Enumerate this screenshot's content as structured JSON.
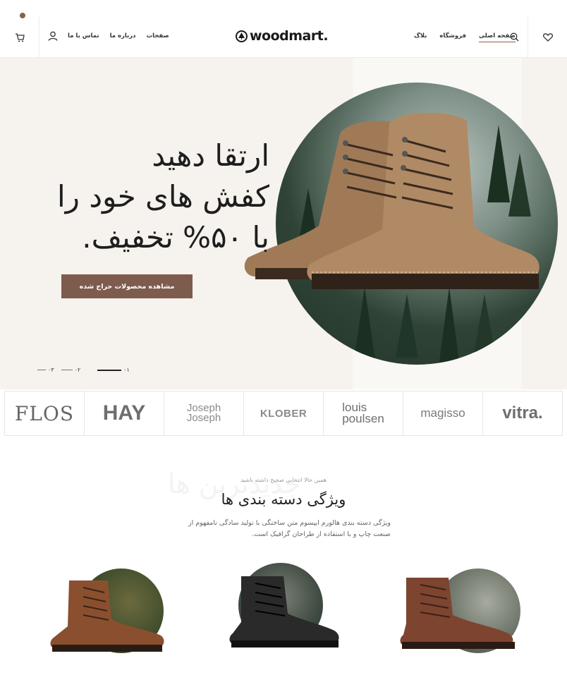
{
  "header": {
    "logo_text": "woodmart.",
    "nav_left": [
      "تماس با ما",
      "درباره ما",
      "صفحات"
    ],
    "nav_right": {
      "blog": "بلاگ",
      "shop": "فروشگاه",
      "home": "صفحه اصلی"
    },
    "icons": [
      "cart-icon",
      "user-icon",
      "search-icon",
      "heart-icon"
    ]
  },
  "hero": {
    "title_lines": [
      "ارتقا دهید",
      "کفش های خود را",
      "با ۵۰% تخفیف."
    ],
    "button_label": "مشاهده محصولات حراج شده",
    "slides": [
      "۰۱",
      "۰۲",
      "۰۳"
    ]
  },
  "brands": {
    "flos": "FLOS",
    "hay": "HAY",
    "joseph": "Joseph\nJoseph",
    "klober": "KLOBER",
    "louis": "louis\npoulsen",
    "magisso": "magisso",
    "vitra": "vitra."
  },
  "categories": {
    "ghost_text": "جدیدترین ها",
    "subtitle": "همین حالا انتخابی صحیح داشته باشید",
    "title": "ویژگی دسته بندی ها",
    "description": "ویژگی دسته بندی هالورم ایپسوم متن ساختگی با تولید سادگی نامفهوم از صنعت چاپ و با استفاده از طراحان گرافیک است."
  },
  "colors": {
    "accent": "#7e5c4d",
    "hero_bg": "#f6f2ee"
  }
}
